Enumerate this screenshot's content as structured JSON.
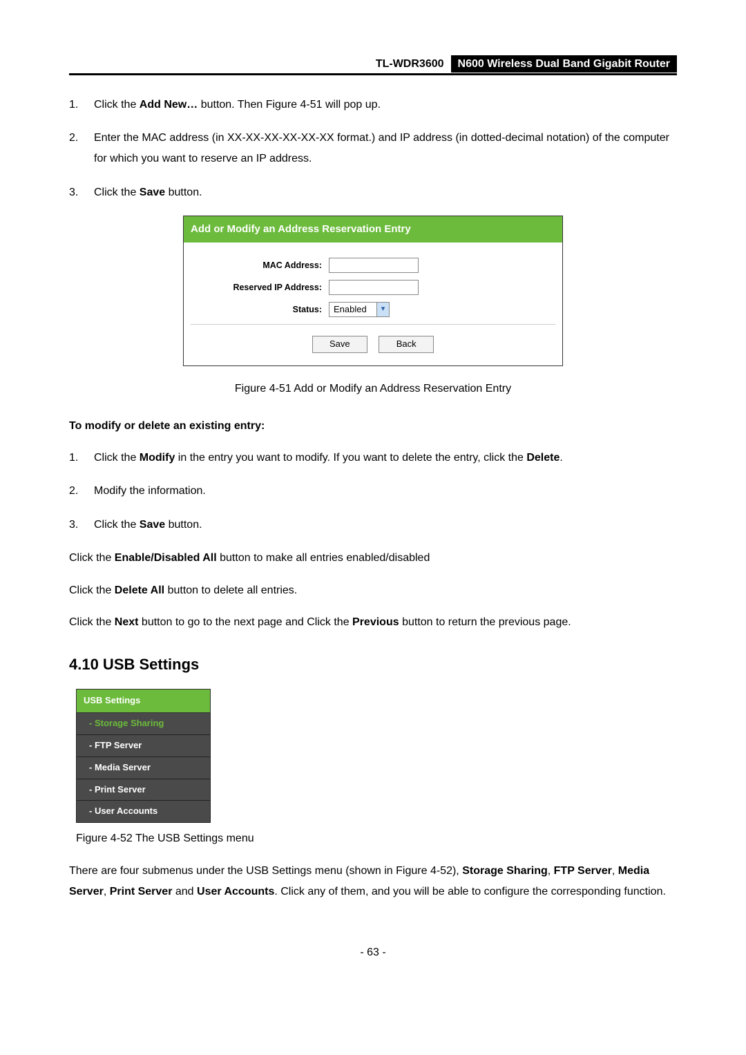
{
  "header": {
    "model": "TL-WDR3600",
    "title": "N600 Wireless Dual Band Gigabit Router"
  },
  "steps1": {
    "s1_a": "Click the ",
    "s1_b": "Add New…",
    "s1_c": " button. Then Figure 4-51 will pop up.",
    "s2": "Enter the MAC address (in XX-XX-XX-XX-XX-XX format.) and IP address (in dotted-decimal notation) of the computer for which you want to reserve an IP address.",
    "s3_a": "Click the ",
    "s3_b": "Save",
    "s3_c": " button."
  },
  "figure1": {
    "title": "Add or Modify an Address Reservation Entry",
    "mac_label": "MAC Address:",
    "ip_label": "Reserved IP Address:",
    "status_label": "Status:",
    "status_value": "Enabled",
    "save_btn": "Save",
    "back_btn": "Back",
    "caption": "Figure 4-51 Add or Modify an Address Reservation Entry"
  },
  "subhead": "To modify or delete an existing entry:",
  "steps2": {
    "s1_a": "Click the ",
    "s1_b": "Modify",
    "s1_c": " in the entry you want to modify. If you want to delete the entry, click the ",
    "s1_d": "Delete",
    "s1_e": ".",
    "s2": "Modify the information.",
    "s3_a": "Click the ",
    "s3_b": "Save",
    "s3_c": " button."
  },
  "paras": {
    "p1_a": "Click the ",
    "p1_b": "Enable/Disabled All",
    "p1_c": " button to make all entries enabled/disabled",
    "p2_a": "Click the ",
    "p2_b": "Delete All",
    "p2_c": " button to delete all entries.",
    "p3_a": "Click the ",
    "p3_b": "Next",
    "p3_c": " button to go to the next page and Click the ",
    "p3_d": "Previous",
    "p3_e": " button to return the previous page."
  },
  "section": "4.10  USB Settings",
  "usb": {
    "header": "USB Settings",
    "items": [
      "- Storage Sharing",
      "- FTP Server",
      "- Media Server",
      "- Print Server",
      "- User Accounts"
    ],
    "caption": "Figure 4-52 The USB Settings menu"
  },
  "final": {
    "a": "There are four submenus under the USB Settings menu (shown in Figure 4-52), ",
    "b": "Storage Sharing",
    "c": ", ",
    "d": "FTP Server",
    "e": ", ",
    "f": "Media Server",
    "g": ", ",
    "h": "Print Server",
    "i": " and ",
    "j": "User Accounts",
    "k": ". Click any of them, and you will be able to configure the corresponding function."
  },
  "page_num": "- 63 -"
}
